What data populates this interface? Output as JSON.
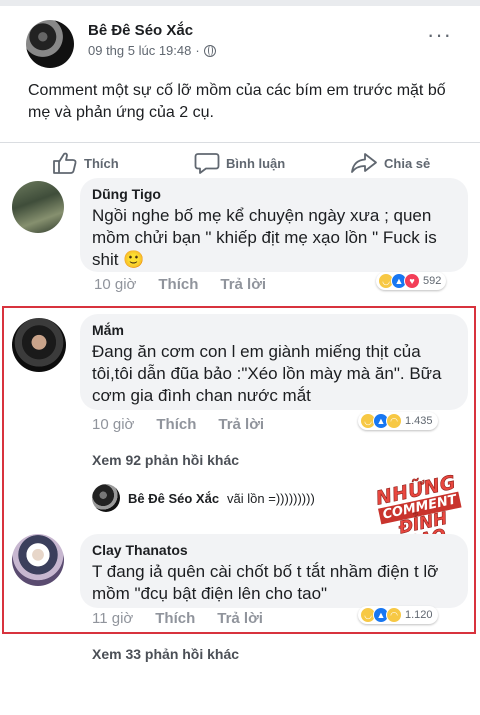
{
  "post": {
    "page_name": "Bê Đê Séo Xắc",
    "timestamp": "09 thg 5 lúc 19:48",
    "meta_separator": "·",
    "text": "Comment một sự cố lỡ mồm của các bím em trước mặt bố mẹ và phản ứng của 2 cụ.",
    "more_label": "···"
  },
  "actions": {
    "like": "Thích",
    "comment": "Bình luận",
    "share": "Chia sẻ"
  },
  "comments": [
    {
      "name": "Dũng Tigo",
      "text": "Ngồi nghe bố mẹ kể chuyện ngày xưa ; quen mồm chửi bạn \" khiếp địt mẹ xạo lồn \" Fuck is shit",
      "emoji": "🙂",
      "time": "10 giờ",
      "like": "Thích",
      "reply": "Trả lời",
      "reaction_count": "592",
      "reactions": [
        "haha",
        "like",
        "love"
      ]
    },
    {
      "name": "Mắm",
      "text": "Đang ăn cơm con l em giành miếng thịt của tôi,tôi dẫn đũa bảo :\"Xéo lồn mày mà ăn\". Bữa cơm gia đình chan nước mắt",
      "time": "10 giờ",
      "like": "Thích",
      "reply": "Trả lời",
      "reaction_count": "1.435",
      "reactions": [
        "haha",
        "like",
        "sad"
      ]
    },
    {
      "name": "Clay Thanatos",
      "text": "T đang iả quên cài chốt bố t tắt nhầm điện t lỡ mồm \"đcụ bật điện lên cho tao\"",
      "time": "11 giờ",
      "like": "Thích",
      "reply": "Trả lời",
      "reaction_count": "1.120",
      "reactions": [
        "haha",
        "like",
        "sad"
      ]
    }
  ],
  "see_more_1": "Xem 92 phản hồi khác",
  "reply_preview": {
    "name": "Bê Đê Séo Xắc",
    "text": "vãi lồn =)))))))))"
  },
  "see_more_2": "Xem 33 phản hồi khác",
  "watermark": {
    "line1": "NHỮNG",
    "line2": "COMMENT",
    "line3": "ĐỈNH CAO"
  },
  "colors": {
    "highlight_border": "#d8323d",
    "bubble": "#f2f3f5",
    "like_blue": "#1877f2"
  }
}
